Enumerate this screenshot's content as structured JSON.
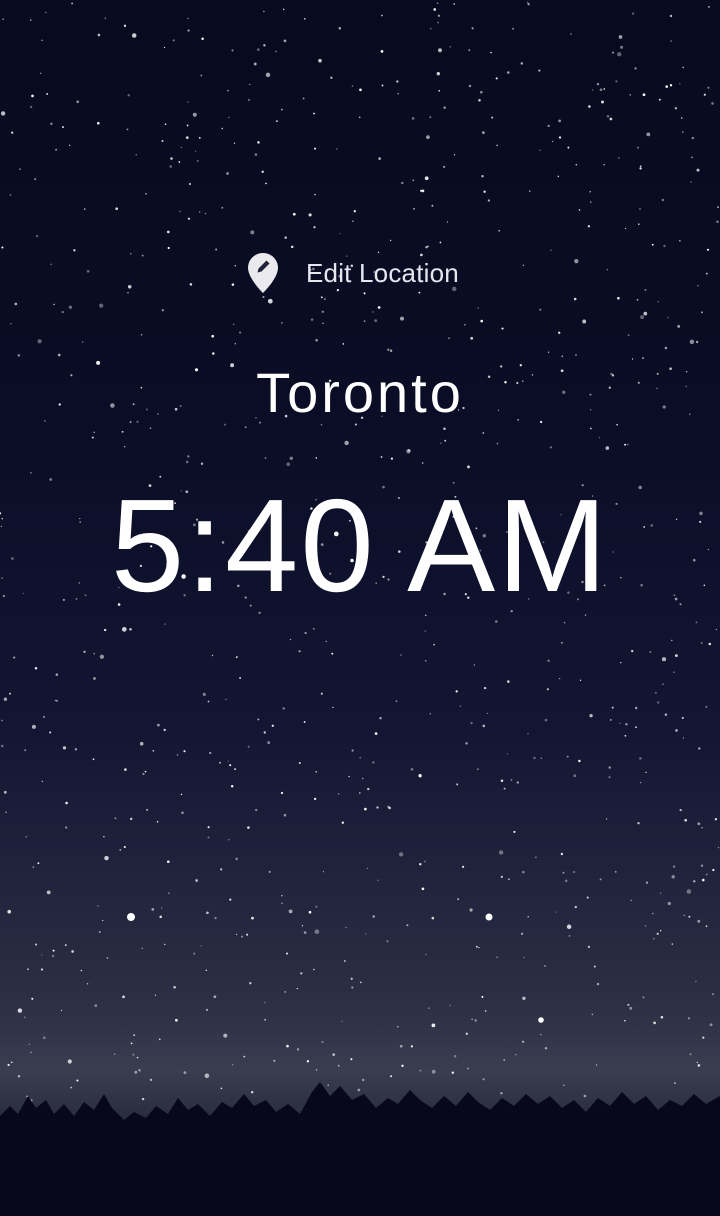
{
  "edit_location": {
    "label": "Edit Location",
    "icon": "location-pin-edit-icon"
  },
  "location": {
    "city": "Toronto"
  },
  "clock": {
    "time": "5:40 AM"
  },
  "background": {
    "scene": "night-sky-stars-treeline",
    "sky_color": "#0b0d26",
    "horizon_glow": "#3a3c50",
    "tree_color": "#07081a"
  }
}
